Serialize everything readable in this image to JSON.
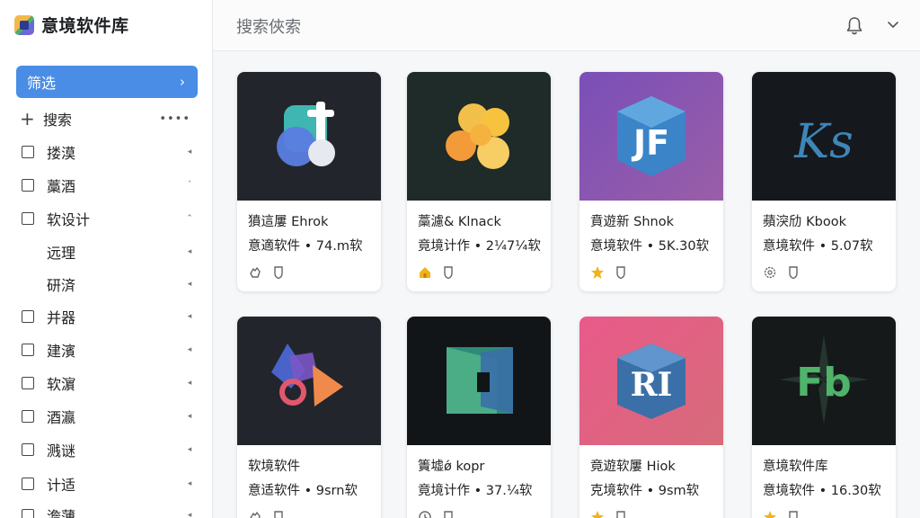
{
  "brand": {
    "title": "意境软件库"
  },
  "sidebar": {
    "filter_label": "筛选",
    "filter_chevron": "›",
    "search_label": "搜索",
    "search_more": "••••",
    "categories": [
      {
        "label": "搂漠",
        "checkbox": true,
        "arrow": "◂"
      },
      {
        "label": "藁酒",
        "checkbox": true,
        "arrow": "ˇ"
      },
      {
        "label": "软设计",
        "checkbox": true,
        "arrow": "⌃"
      },
      {
        "label": "远理",
        "checkbox": false,
        "arrow": "◂"
      },
      {
        "label": "研済",
        "checkbox": false,
        "arrow": "◂"
      },
      {
        "label": "并器",
        "checkbox": true,
        "arrow": "◂"
      },
      {
        "label": "建濱",
        "checkbox": true,
        "arrow": "◂"
      },
      {
        "label": "软濵",
        "checkbox": true,
        "arrow": "◂"
      },
      {
        "label": "酒瀛",
        "checkbox": true,
        "arrow": "◂"
      },
      {
        "label": "溅谜",
        "checkbox": true,
        "arrow": "◂"
      },
      {
        "label": "计适",
        "checkbox": true,
        "arrow": "◂"
      },
      {
        "label": "澹薄",
        "checkbox": true,
        "arrow": "◂"
      }
    ]
  },
  "header": {
    "search_placeholder": "搜索俠索",
    "icons": [
      "bell-icon",
      "chevron-down-icon"
    ]
  },
  "cards": [
    {
      "title": "獖這屢 Ehrok",
      "meta": "意適软件 • 74.m软",
      "logo_text": "",
      "icons": [
        "hand-icon",
        "shield-icon"
      ]
    },
    {
      "title": "藁濾& Klnack",
      "meta": "竟境计作 • 2¼7¼软",
      "logo_text": "",
      "icons": [
        "home-icon",
        "shield-icon"
      ]
    },
    {
      "title": "賁遊新 Shnok",
      "meta": "意境软件 • 5K.30软",
      "logo_text": "JF",
      "icons": [
        "star-icon",
        "shield-icon"
      ]
    },
    {
      "title": "蘋湥劤 Kbook",
      "meta": "意境软件 • 5.07软",
      "logo_text": "Ks",
      "icons": [
        "gear-icon",
        "shield-icon"
      ]
    },
    {
      "title": "软境软件",
      "meta": "意适软件 • 9srn软",
      "logo_text": "",
      "icons": [
        "hand-icon",
        "shield-icon"
      ]
    },
    {
      "title": "簀墟ǿ kopr",
      "meta": "竟境计作 • 37.¼软",
      "logo_text": "",
      "icons": [
        "clock-icon",
        "shield-icon"
      ]
    },
    {
      "title": "竟遊软屢 Hiok",
      "meta": "克境软件 • 9sm软",
      "logo_text": "RI",
      "icons": [
        "star-icon",
        "shield-icon"
      ]
    },
    {
      "title": "意境软件库",
      "meta": "意境软件 • 16.30软",
      "logo_text": "Fb",
      "icons": [
        "star-icon",
        "shield-icon"
      ]
    }
  ],
  "colors": {
    "accent": "#4a8de6",
    "star": "#f2b218"
  }
}
